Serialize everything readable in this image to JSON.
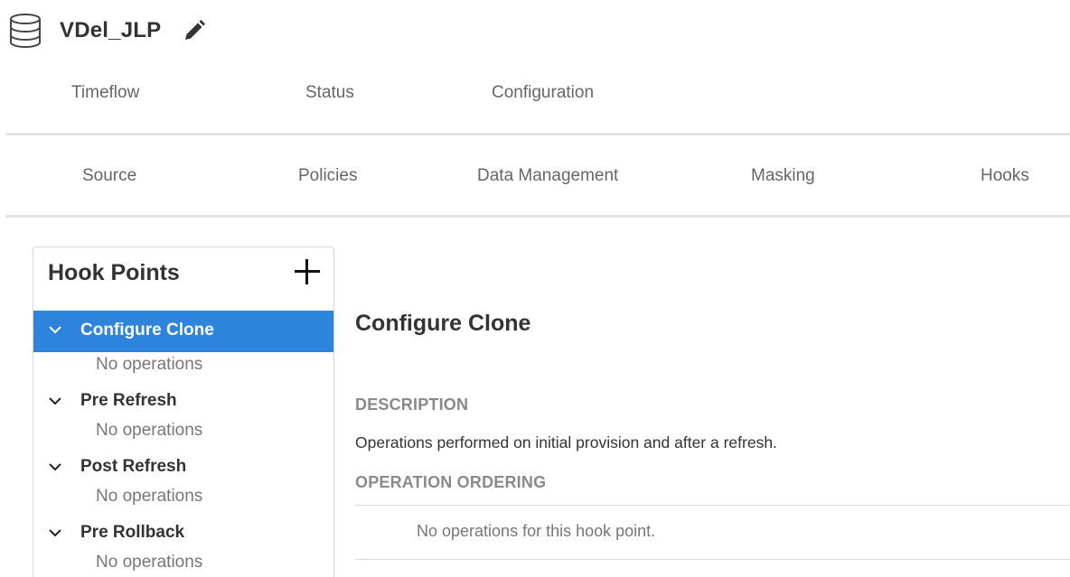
{
  "header": {
    "title": "VDel_JLP",
    "db_icon": "database-icon",
    "edit_icon": "pencil-icon"
  },
  "top_tabs": [
    "Timeflow",
    "Status",
    "Configuration"
  ],
  "sub_tabs": [
    "Source",
    "Policies",
    "Data Management",
    "Masking",
    "Hooks"
  ],
  "hook_points": {
    "title": "Hook Points",
    "add_icon": "plus-icon",
    "items": [
      {
        "label": "Configure Clone",
        "sub": "No operations",
        "selected": true
      },
      {
        "label": "Pre Refresh",
        "sub": "No operations",
        "selected": false
      },
      {
        "label": "Post Refresh",
        "sub": "No operations",
        "selected": false
      },
      {
        "label": "Pre Rollback",
        "sub": "No operations",
        "selected": false
      }
    ]
  },
  "detail": {
    "title": "Configure Clone",
    "description_label": "DESCRIPTION",
    "description": "Operations performed on initial provision and after a refresh.",
    "ordering_label": "OPERATION ORDERING",
    "empty_message": "No operations for this hook point."
  },
  "colors": {
    "accent": "#2e84dd",
    "text": "#333333",
    "muted": "#777777",
    "divider": "#e4e4e4"
  }
}
